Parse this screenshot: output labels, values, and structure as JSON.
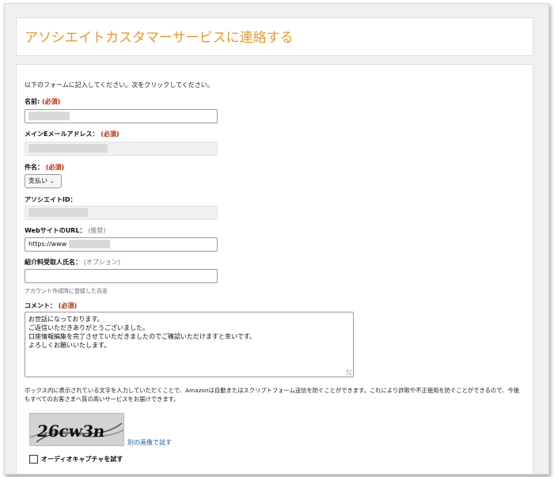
{
  "header": {
    "title": "アソシエイトカスタマーサービスに連絡する"
  },
  "form": {
    "intro": "以下のフォームに記入してください。次をクリックしてください。",
    "name": {
      "label": "名前:",
      "required": "(必須)",
      "value": ""
    },
    "email": {
      "label": "メインEメールアドレス：",
      "required": "(必須)",
      "value": ""
    },
    "subject": {
      "label": "件名：",
      "required": "(必須)",
      "selected": "支払い"
    },
    "associate_id": {
      "label": "アソシエイトID：",
      "value": ""
    },
    "website": {
      "label": "WebサイトのURL：",
      "note": "(推奨)",
      "value": "https://www"
    },
    "payee": {
      "label": "紹介料受取人氏名：",
      "note": "(オプション)",
      "value": "",
      "hint": "アカウント作成時に登録した氏名"
    },
    "comment": {
      "label": "コメント：",
      "required": "(必須)",
      "lines": [
        "お世話になっております。",
        "ご返信いただきありがとうございました。",
        "口座情報編集を完了させていただきましたのでご確認いただけますと幸いです。",
        "よろしくお願いいたします。"
      ]
    },
    "captcha_text": "ボックス内に表示されている文字を入力していただくことで、Amazonは自動またはスクリプトフォーム送信を防ぐことができます。これにより詐欺や不正使用を防ぐことができるので、今後もすべてのお客さまへ質の高いサービスをお届けできます。",
    "captcha_image_text": "26cw3n",
    "captcha_alt_link": "別の画像で試す",
    "audio_captcha_label": "オーディオキャプチャを試す"
  },
  "colors": {
    "title": "#e29b2d",
    "required": "#b12704",
    "link": "#1a5d9c"
  }
}
